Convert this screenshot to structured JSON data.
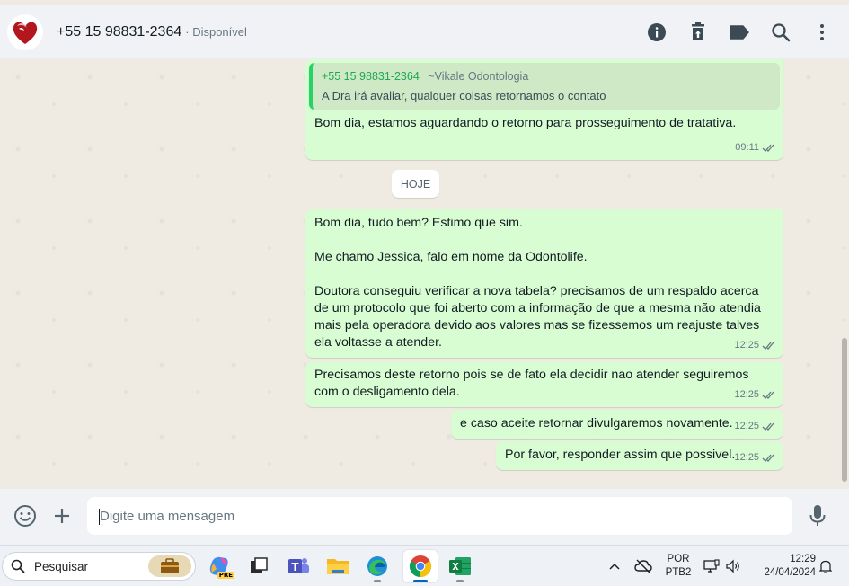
{
  "header": {
    "contact_name": "+55 15 98831-2364",
    "contact_status": "· Disponível",
    "icons": [
      "info-icon",
      "delete-icon",
      "label-icon",
      "search-icon",
      "menu-icon"
    ]
  },
  "messages": {
    "quoted": {
      "sender": "+55 15 98831-2364",
      "alias": "~Vikale Odontologia",
      "text": "A Dra irá avaliar, qualquer coisas retornamos o contato"
    },
    "m1": {
      "text": "Bom dia, estamos aguardando o retorno para prosseguimento de tratativa.",
      "time": "09:11"
    },
    "day_separator": "HOJE",
    "m2": {
      "text": "Bom dia, tudo bem? Estimo que sim.\n\nMe chamo Jessica, falo em nome da Odontolife.\n\nDoutora conseguiu verificar a nova tabela? precisamos de um respaldo acerca de um protocolo que foi aberto com a informação de que a mesma não atendia mais pela operadora devido aos valores mas se fizessemos um reajuste talves ela voltasse a atender.",
      "time": "12:25"
    },
    "m3": {
      "text": "Precisamos deste retorno pois se de fato ela decidir nao atender seguiremos com o desligamento dela.",
      "time": "12:25"
    },
    "m4": {
      "text": "e caso aceite retornar divulgaremos novamente.",
      "time": "12:25"
    },
    "m5": {
      "text": "Por favor, responder assim que possivel.",
      "time": "12:25"
    }
  },
  "composer": {
    "placeholder": "Digite uma mensagem"
  },
  "taskbar": {
    "search_label": "Pesquisar",
    "language_top": "POR",
    "language_bottom": "PTB2",
    "time": "12:29",
    "date": "24/04/2024",
    "promo_badge": "PRE"
  },
  "colors": {
    "outgoing_bubble": "#d9fdd3",
    "chat_bg": "#efeae2",
    "header_bg": "#f0f2f5",
    "quote_accent": "#25d366",
    "read_ticks": "#667781"
  }
}
